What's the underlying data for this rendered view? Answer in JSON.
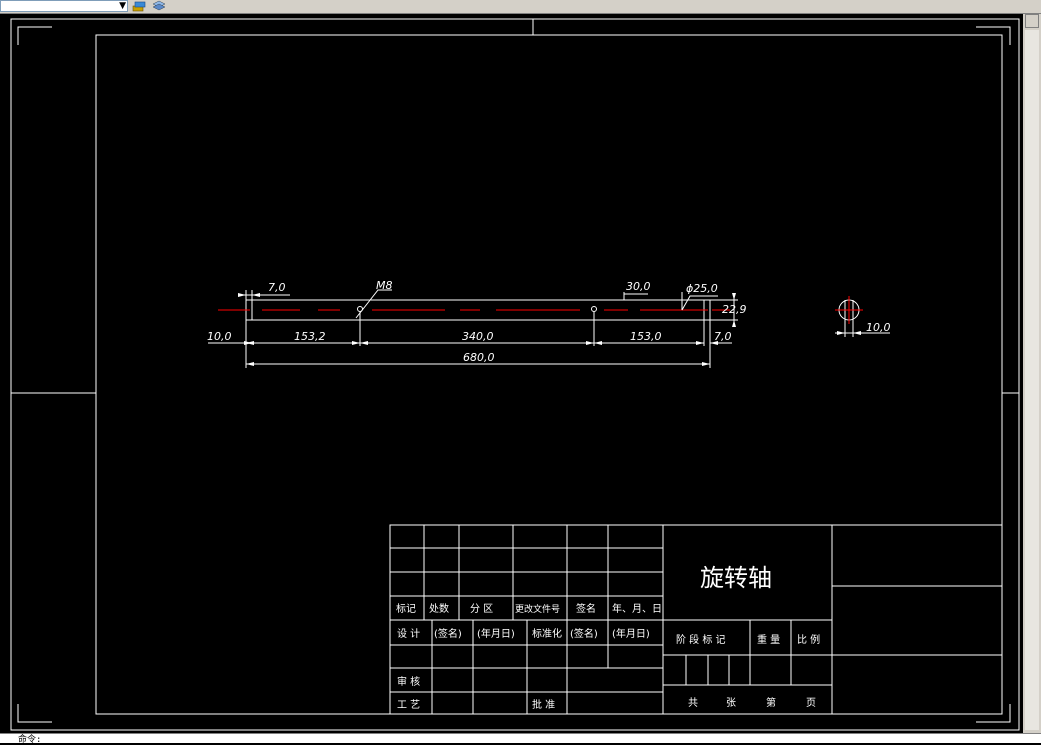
{
  "toolbar": {
    "layer_value": "",
    "dropdown_icon": "chevron-down-icon",
    "tool_icons": [
      "layer-state-icon",
      "layers-icon"
    ]
  },
  "drawing": {
    "colors": {
      "background": "#000000",
      "lines": "#ffffff",
      "centerline": "#ff0000"
    },
    "dimensions": {
      "d_7_0_left": "7,0",
      "m8": "M8",
      "d_30_0": "30,0",
      "phi_25_0": "ϕ25,0",
      "d_22_9": "22,9",
      "d_10_0_left": "10,0",
      "d_153_2": "153,2",
      "d_340_0": "340,0",
      "d_153_0": "153,0",
      "d_7_0_right": "7,0",
      "d_680_0": "680,0",
      "d_10_0_section": "10,0"
    }
  },
  "title_block": {
    "part_name": "旋转轴",
    "header_labels": {
      "mark": "标记",
      "count": "处数",
      "zone": "分 区",
      "change_doc": "更改文件号",
      "sign": "签名",
      "date": "年、月、日"
    },
    "row_design": {
      "label": "设 计",
      "sign": "(签名)",
      "date": "(年月日)",
      "standard": "标准化",
      "sign2": "(签名)",
      "date2": "(年月日)"
    },
    "review_label": "审 核",
    "process_label": "工 艺",
    "approve_label": "批 准",
    "stage_label": "阶 段 标 记",
    "weight_label": "重 量",
    "scale_label": "比 例",
    "sheet": {
      "total": "共",
      "sheets": "张",
      "nth": "第",
      "page": "页"
    }
  },
  "command_line": {
    "text": "命令: "
  }
}
